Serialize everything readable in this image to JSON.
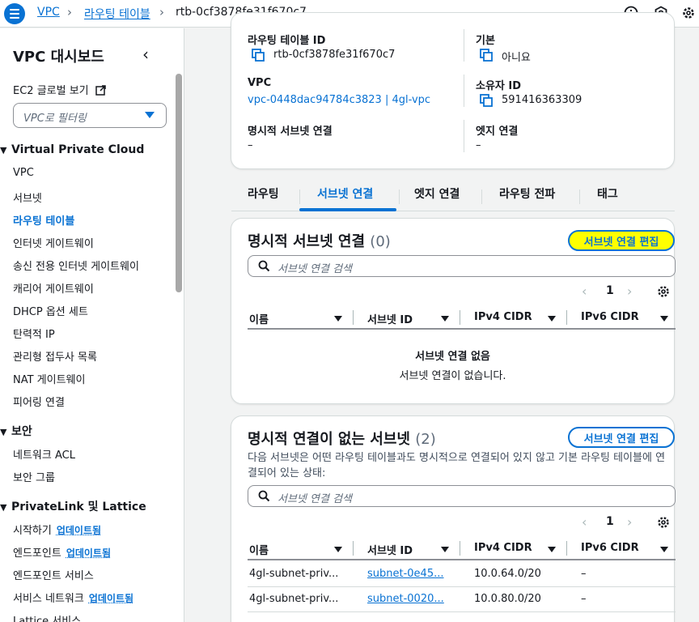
{
  "colors": {
    "link": "#0972d3",
    "highlight": "#ffff00",
    "border": "#d5dbdb"
  },
  "breadcrumb": {
    "vpc": "VPC",
    "route_tables": "라우팅 테이블",
    "current": "rtb-0cf3878fe31f670c7"
  },
  "top_icons": [
    "info-icon",
    "notification-icon",
    "settings-icon"
  ],
  "sidebar": {
    "title": "VPC 대시보드",
    "ec2_global": "EC2 글로벌 보기",
    "filter_placeholder": "VPC로 필터링",
    "sections": {
      "vpc": "Virtual Private Cloud",
      "security": "보안",
      "privatelink": "PrivateLink 및 Lattice"
    },
    "vpc_items": [
      "VPC",
      "서브넷",
      "라우팅 테이블",
      "인터넷 게이트웨이",
      "송신 전용 인터넷 게이트웨이",
      "캐리어 게이트웨이",
      "DHCP 옵션 세트",
      "탄력적 IP",
      "관리형 접두사 목록",
      "NAT 게이트웨이",
      "피어링 연결"
    ],
    "security_items": [
      "네트워크 ACL",
      "보안 그룹"
    ],
    "privatelink_items": [
      "시작하기",
      "엔드포인트",
      "엔드포인트 서비스",
      "서비스 네트워크",
      "Lattice 서비스"
    ],
    "update_badge": "업데이트됨"
  },
  "details": {
    "route_table_id_label": "라우팅 테이블 ID",
    "route_table_id": "rtb-0cf3878fe31f670c7",
    "main_label": "기본",
    "main_value": "아니요",
    "vpc_label": "VPC",
    "vpc_value": "vpc-0448dac94784c3823 | 4gl-vpc",
    "owner_label": "소유자 ID",
    "owner_value": "591416363309",
    "explicit_label": "명시적 서브넷 연결",
    "explicit_value": "–",
    "edge_label": "엣지 연결",
    "edge_value": "–"
  },
  "tabs": [
    "라우팅",
    "서브넷 연결",
    "엣지 연결",
    "라우팅 전파",
    "태그"
  ],
  "explicit_section": {
    "title": "명시적 서브넷 연결",
    "count": "(0)",
    "edit_button": "서브넷 연결 편집",
    "search_placeholder": "서브넷 연결 검색",
    "page": "1",
    "columns": [
      "이름",
      "서브넷 ID",
      "IPv4 CIDR",
      "IPv6 CIDR"
    ],
    "empty_title": "서브넷 연결 없음",
    "empty_sub": "서브넷 연결이 없습니다."
  },
  "implicit_section": {
    "title": "명시적 연결이 없는 서브넷",
    "count": "(2)",
    "edit_button": "서브넷 연결 편집",
    "description": "다음 서브넷은 어떤 라우팅 테이블과도 명시적으로 연결되어 있지 않고 기본 라우팅 테이블에 연결되어 있는 상태:",
    "search_placeholder": "서브넷 연결 검색",
    "page": "1",
    "columns": [
      "이름",
      "서브넷 ID",
      "IPv4 CIDR",
      "IPv6 CIDR"
    ],
    "rows": [
      {
        "name": "4gl-subnet-priv...",
        "subnet": "subnet-0e45...",
        "ipv4": "10.0.64.0/20",
        "ipv6": "–"
      },
      {
        "name": "4gl-subnet-priv...",
        "subnet": "subnet-0020...",
        "ipv4": "10.0.80.0/20",
        "ipv6": "–"
      }
    ]
  }
}
